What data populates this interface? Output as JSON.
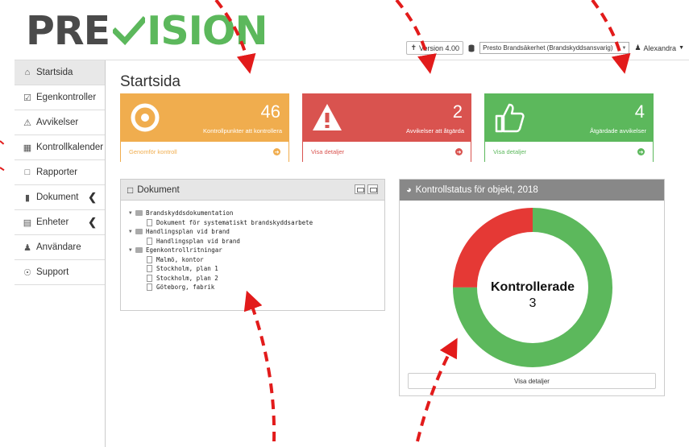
{
  "header": {
    "logo_pre": "PRE",
    "logo_vision": "ISION",
    "version_label": "Version 4.00",
    "org_select_value": "Presto Brandsäkerhet (Brandskyddsansvarig)",
    "user_name": "Alexandra"
  },
  "sidebar": {
    "items": [
      {
        "label": "Startsida",
        "icon": "home-icon"
      },
      {
        "label": "Egenkontroller",
        "icon": "check-square-icon"
      },
      {
        "label": "Avvikelser",
        "icon": "warning-icon"
      },
      {
        "label": "Kontrollkalender",
        "icon": "calendar-icon"
      },
      {
        "label": "Rapporter",
        "icon": "file-pdf-icon"
      },
      {
        "label": "Dokument",
        "icon": "file-icon"
      },
      {
        "label": "Enheter",
        "icon": "device-icon"
      },
      {
        "label": "Användare",
        "icon": "user-icon"
      },
      {
        "label": "Support",
        "icon": "lifebuoy-icon"
      }
    ]
  },
  "main": {
    "title": "Startsida",
    "cards": [
      {
        "count": "46",
        "label": "Kontrollpunkter att kontrollera",
        "link": "Genomför kontroll",
        "color": "#f0ad4e"
      },
      {
        "count": "2",
        "label": "Avvikelser att åtgärda",
        "link": "Visa detaljer",
        "color": "#d9534f"
      },
      {
        "count": "4",
        "label": "Åtgärdade avvikelser",
        "link": "Visa detaljer",
        "color": "#5cb85c"
      }
    ],
    "documents": {
      "title": "Dokument",
      "tree": [
        {
          "type": "folder",
          "label": "Brandskyddsdokumentation"
        },
        {
          "type": "file",
          "label": "Dokument för systematiskt brandskyddsarbete"
        },
        {
          "type": "folder",
          "label": "Handlingsplan vid brand"
        },
        {
          "type": "file",
          "label": "Handlingsplan vid brand"
        },
        {
          "type": "folder",
          "label": "Egenkontrollritningar"
        },
        {
          "type": "file",
          "label": "Malmö, kontor"
        },
        {
          "type": "file",
          "label": "Stockholm, plan 1"
        },
        {
          "type": "file",
          "label": "Stockholm, plan 2"
        },
        {
          "type": "file",
          "label": "Göteborg, fabrik"
        }
      ]
    },
    "status_chart": {
      "title": "Kontrollstatus för objekt, 2018",
      "center_label": "Kontrollerade",
      "center_value": "3",
      "button_label": "Visa detaljer",
      "segments": [
        {
          "share": 0.75,
          "color": "#5cb85c"
        },
        {
          "share": 0.25,
          "color": "#e53935"
        }
      ]
    }
  }
}
